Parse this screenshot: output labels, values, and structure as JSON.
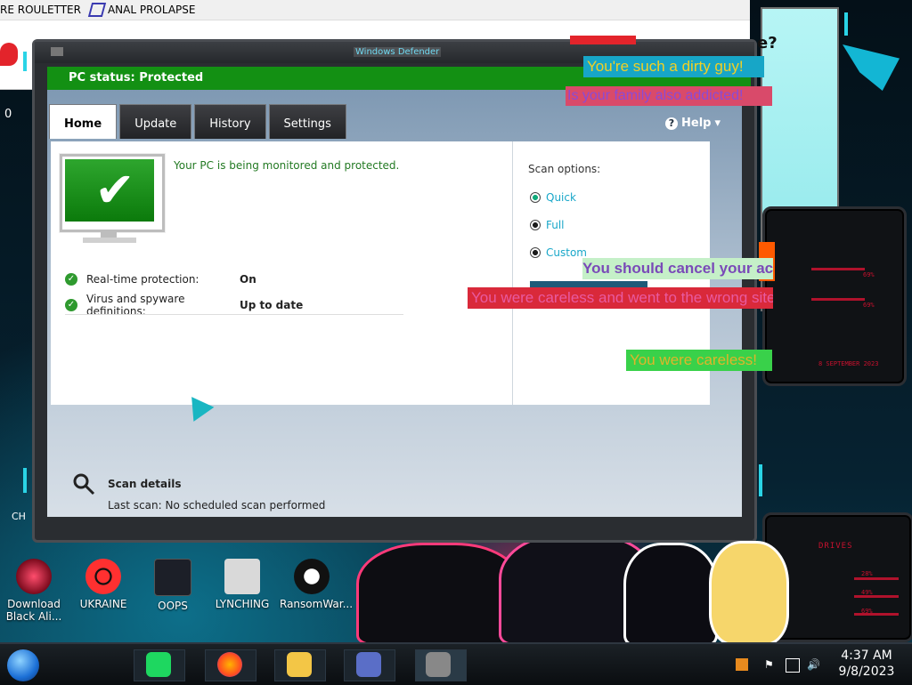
{
  "browser": {
    "tabs": [
      {
        "label": "RE ROULETTER"
      },
      {
        "label": "ANAL PROLAPSE"
      }
    ],
    "counter": "0"
  },
  "right_app": {
    "question_mark": "e?"
  },
  "defender": {
    "window_title": "Windows Defender",
    "status_bar": "PC status: Protected",
    "tabs": [
      {
        "label": "Home",
        "active": true
      },
      {
        "label": "Update",
        "active": false
      },
      {
        "label": "History",
        "active": false
      },
      {
        "label": "Settings",
        "active": false
      }
    ],
    "help_label": "Help",
    "status_message": "Your PC is being monitored and protected.",
    "stats": [
      {
        "label": "Real-time protection:",
        "value": "On"
      },
      {
        "label": "Virus and spyware definitions:",
        "value": "Up to date"
      }
    ],
    "scan_options": {
      "title": "Scan options:",
      "options": [
        {
          "label": "Quick",
          "selected": true
        },
        {
          "label": "Full",
          "selected": false
        },
        {
          "label": "Custom",
          "selected": false
        }
      ]
    },
    "scan_details": {
      "title": "Scan details",
      "last_scan_label": "Last scan:",
      "last_scan_value": "No scheduled scan performed"
    }
  },
  "overlays": [
    {
      "text": "You're such a dirty guy!",
      "color": "#f2d024",
      "bg": "#17a6c7"
    },
    {
      "text": "Is your family also addicted!",
      "color": "#8a4bd6",
      "bg": "#d94a6a"
    },
    {
      "text": "You should cancel your account!",
      "color": "#7a4ab8",
      "bg": "#c5f0c8"
    },
    {
      "text": "You were careless and went to the wrong site!",
      "color": "#e85aa0",
      "bg": "#d9293a"
    },
    {
      "text": "You were careless!",
      "color": "#e0b52a",
      "bg": "#39d14a"
    }
  ],
  "hud": {
    "panel_1_pct": [
      "69%",
      "69%"
    ],
    "panel_1_date": "8 SEPTEMBER 2023",
    "panel_2_title": "DRIVES",
    "panel_2_pct": [
      "28%",
      "49%",
      "69%"
    ]
  },
  "desktop_icons": [
    {
      "label": "Download Black Ali..."
    },
    {
      "label": "UKRAINE"
    },
    {
      "label": "OOPS"
    },
    {
      "label": "LYNCHING"
    },
    {
      "label": "RansomWar..."
    }
  ],
  "desktop_fragment": "CH",
  "taskbar": {
    "time": "4:37 AM",
    "date": "9/8/2023"
  },
  "colors": {
    "status_green": "#139013",
    "accent_cyan": "#2ad4e6",
    "hud_red": "#c8112e"
  }
}
